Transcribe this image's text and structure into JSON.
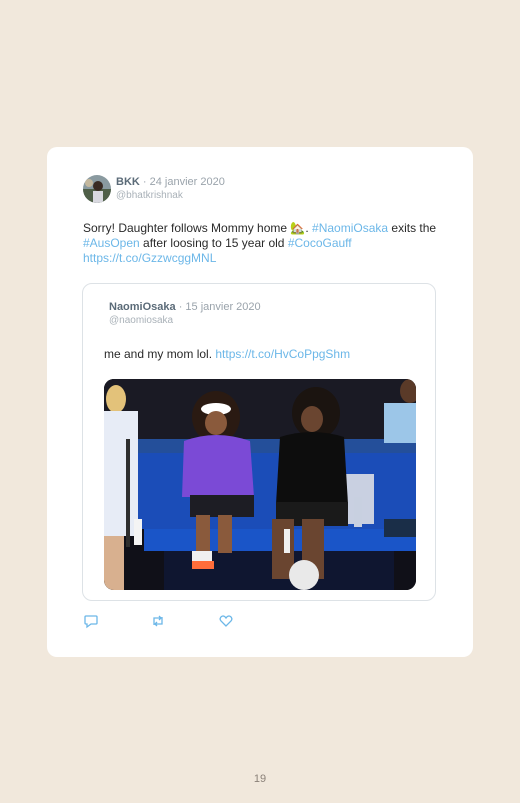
{
  "tweet": {
    "author_name": "BKK",
    "date": " · 24 janvier 2020",
    "handle": "@bhatkrishnak",
    "text_part1": "Sorry! Daughter follows Mommy home ",
    "emoji": "🏡",
    "text_part2": ". ",
    "hashtag1": "#NaomiOsaka",
    "text_part3": " exits the ",
    "hashtag2": "#AusOpen",
    "text_part4": " after loosing to 15 year old ",
    "hashtag3": "#CocoGauff",
    "link": "https://t.co/GzzwcggMNL"
  },
  "quoted_tweet": {
    "author_name": "NaomiOsaka",
    "date": " · 15 janvier 2020",
    "handle": "@naomiosaka",
    "text": "me and my mom lol. ",
    "link": "https://t.co/HvCoPpgShm"
  },
  "actions": {
    "reply_icon": "reply-icon",
    "retweet_icon": "retweet-icon",
    "like_icon": "heart-icon"
  },
  "page": {
    "number": "19"
  },
  "colors": {
    "background": "#f1e8dc",
    "link": "#6cb7e8",
    "card": "#ffffff"
  }
}
